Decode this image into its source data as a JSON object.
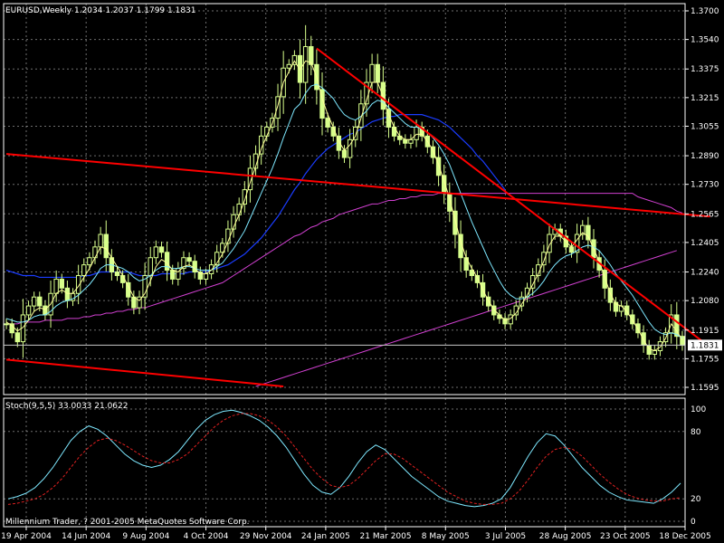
{
  "header": {
    "symbol_line": "EURUSD,Weekly  1.2034 1.2037 1.1799 1.1831",
    "stoch_line": "Stoch(9,5,5) 33.0033 21.0622",
    "copyright": "Millennium Trader, ? 2001-2005 MetaQuotes Software Corp.",
    "price_tag": "1.1831"
  },
  "colors": {
    "background": "#000000",
    "grid": "#c8c8c8",
    "candle_body": "#d8ff8c",
    "ma_fast": "#ffff99",
    "ma_mid": "#7ee8ff",
    "ma_slow": "#1a3cff",
    "ma_long": "#d040d0",
    "trendline": "#ff0000",
    "stoch_main": "#7ee8ff",
    "stoch_signal": "#e02020"
  },
  "chart_data": [
    {
      "type": "candlestick",
      "title": "EURUSD,Weekly",
      "x_tick_labels": [
        "19 Apr 2004",
        "14 Jun 2004",
        "9 Aug 2004",
        "4 Oct 2004",
        "29 Nov 2004",
        "24 Jan 2005",
        "21 Mar 2005",
        "8 May 2005",
        "3 Jul 2005",
        "28 Aug 2005",
        "23 Oct 2005",
        "18 Dec 2005"
      ],
      "y_tick_labels": [
        "1.3700",
        "1.3540",
        "1.3375",
        "1.3215",
        "1.3055",
        "1.2890",
        "1.2730",
        "1.2565",
        "1.2405",
        "1.2240",
        "1.2080",
        "1.1915",
        "1.1755",
        "1.1595"
      ],
      "ylim": [
        1.1595,
        1.37
      ],
      "current_price": 1.1831,
      "closes": [
        1.195,
        1.19,
        1.185,
        1.2,
        1.205,
        1.21,
        1.205,
        1.2,
        1.212,
        1.22,
        1.215,
        1.208,
        1.212,
        1.222,
        1.228,
        1.232,
        1.238,
        1.245,
        1.232,
        1.224,
        1.222,
        1.218,
        1.21,
        1.204,
        1.21,
        1.222,
        1.232,
        1.238,
        1.235,
        1.225,
        1.22,
        1.226,
        1.232,
        1.23,
        1.224,
        1.22,
        1.223,
        1.228,
        1.235,
        1.24,
        1.248,
        1.256,
        1.262,
        1.27,
        1.282,
        1.29,
        1.3,
        1.305,
        1.31,
        1.322,
        1.338,
        1.34,
        1.345,
        1.33,
        1.35,
        1.34,
        1.326,
        1.31,
        1.305,
        1.3,
        1.292,
        1.288,
        1.298,
        1.305,
        1.318,
        1.33,
        1.34,
        1.33,
        1.315,
        1.305,
        1.3,
        1.298,
        1.296,
        1.298,
        1.305,
        1.3,
        1.294,
        1.288,
        1.278,
        1.268,
        1.258,
        1.245,
        1.232,
        1.225,
        1.222,
        1.218,
        1.21,
        1.205,
        1.2,
        1.198,
        1.195,
        1.2,
        1.205,
        1.21,
        1.215,
        1.222,
        1.228,
        1.235,
        1.245,
        1.248,
        1.244,
        1.238,
        1.235,
        1.245,
        1.25,
        1.242,
        1.232,
        1.225,
        1.215,
        1.207,
        1.202,
        1.205,
        1.2,
        1.195,
        1.19,
        1.183,
        1.178,
        1.18,
        1.185,
        1.19,
        1.2,
        1.188,
        1.183
      ],
      "series": [
        {
          "name": "ma_fast",
          "values": [
            1.196,
            1.194,
            1.191,
            1.193,
            1.197,
            1.202,
            1.204,
            1.203,
            1.206,
            1.212,
            1.214,
            1.212,
            1.212,
            1.216,
            1.221,
            1.226,
            1.232,
            1.238,
            1.237,
            1.232,
            1.227,
            1.222,
            1.216,
            1.21,
            1.208,
            1.212,
            1.219,
            1.227,
            1.231,
            1.229,
            1.225,
            1.224,
            1.227,
            1.228,
            1.226,
            1.223,
            1.223,
            1.225,
            1.229,
            1.234,
            1.241,
            1.249,
            1.256,
            1.264,
            1.274,
            1.283,
            1.293,
            1.3,
            1.307,
            1.317,
            1.33,
            1.336,
            1.342,
            1.337,
            1.342,
            1.341,
            1.333,
            1.321,
            1.312,
            1.305,
            1.297,
            1.292,
            1.295,
            1.3,
            1.31,
            1.32,
            1.33,
            1.33,
            1.322,
            1.312,
            1.305,
            1.3,
            1.298,
            1.298,
            1.301,
            1.301,
            1.297,
            1.292,
            1.284,
            1.275,
            1.265,
            1.253,
            1.241,
            1.232,
            1.226,
            1.221,
            1.214,
            1.208,
            1.203,
            1.2,
            1.197,
            1.198,
            1.201,
            1.206,
            1.211,
            1.217,
            1.223,
            1.23,
            1.239,
            1.244,
            1.244,
            1.241,
            1.238,
            1.242,
            1.246,
            1.244,
            1.237,
            1.23,
            1.221,
            1.212,
            1.206,
            1.205,
            1.202,
            1.197,
            1.192,
            1.186,
            1.181,
            1.18,
            1.182,
            1.187,
            1.195,
            1.191,
            1.186
          ]
        },
        {
          "name": "ma_mid",
          "values": [
            1.198,
            1.197,
            1.196,
            1.196,
            1.197,
            1.199,
            1.2,
            1.2,
            1.202,
            1.205,
            1.207,
            1.208,
            1.209,
            1.211,
            1.214,
            1.217,
            1.221,
            1.226,
            1.228,
            1.228,
            1.227,
            1.226,
            1.224,
            1.221,
            1.219,
            1.22,
            1.222,
            1.225,
            1.227,
            1.227,
            1.226,
            1.226,
            1.227,
            1.227,
            1.226,
            1.225,
            1.225,
            1.225,
            1.227,
            1.229,
            1.233,
            1.237,
            1.242,
            1.247,
            1.254,
            1.261,
            1.268,
            1.275,
            1.282,
            1.29,
            1.299,
            1.307,
            1.315,
            1.318,
            1.324,
            1.328,
            1.329,
            1.327,
            1.324,
            1.321,
            1.316,
            1.312,
            1.31,
            1.309,
            1.311,
            1.314,
            1.318,
            1.32,
            1.319,
            1.316,
            1.313,
            1.31,
            1.307,
            1.305,
            1.305,
            1.304,
            1.302,
            1.299,
            1.295,
            1.29,
            1.284,
            1.276,
            1.268,
            1.26,
            1.252,
            1.245,
            1.238,
            1.231,
            1.225,
            1.219,
            1.214,
            1.211,
            1.209,
            1.209,
            1.21,
            1.212,
            1.215,
            1.219,
            1.224,
            1.228,
            1.231,
            1.233,
            1.234,
            1.236,
            1.238,
            1.239,
            1.238,
            1.236,
            1.232,
            1.228,
            1.223,
            1.219,
            1.215,
            1.211,
            1.206,
            1.201,
            1.196,
            1.192,
            1.19,
            1.189,
            1.19,
            1.189,
            1.187
          ]
        },
        {
          "name": "ma_slow",
          "values": [
            1.225,
            1.224,
            1.223,
            1.222,
            1.222,
            1.222,
            1.221,
            1.221,
            1.221,
            1.221,
            1.221,
            1.221,
            1.221,
            1.221,
            1.222,
            1.222,
            1.223,
            1.224,
            1.224,
            1.224,
            1.224,
            1.224,
            1.224,
            1.223,
            1.222,
            1.222,
            1.222,
            1.222,
            1.223,
            1.223,
            1.223,
            1.223,
            1.223,
            1.224,
            1.224,
            1.224,
            1.224,
            1.225,
            1.226,
            1.227,
            1.228,
            1.23,
            1.232,
            1.234,
            1.237,
            1.24,
            1.243,
            1.247,
            1.251,
            1.255,
            1.26,
            1.265,
            1.27,
            1.274,
            1.279,
            1.283,
            1.287,
            1.29,
            1.293,
            1.295,
            1.297,
            1.299,
            1.301,
            1.302,
            1.304,
            1.306,
            1.308,
            1.309,
            1.31,
            1.311,
            1.311,
            1.312,
            1.312,
            1.312,
            1.312,
            1.312,
            1.311,
            1.31,
            1.309,
            1.307,
            1.305,
            1.302,
            1.299,
            1.296,
            1.293,
            1.289,
            1.286,
            1.282,
            1.278,
            1.274,
            1.27
          ]
        },
        {
          "name": "ma_long",
          "values": [
            1.195,
            1.195,
            1.195,
            1.196,
            1.196,
            1.196,
            1.196,
            1.197,
            1.197,
            1.197,
            1.197,
            1.198,
            1.198,
            1.198,
            1.199,
            1.199,
            1.2,
            1.2,
            1.201,
            1.201,
            1.202,
            1.202,
            1.203,
            1.203,
            1.204,
            1.204,
            1.205,
            1.206,
            1.207,
            1.208,
            1.209,
            1.21,
            1.211,
            1.212,
            1.213,
            1.214,
            1.215,
            1.216,
            1.217,
            1.218,
            1.22,
            1.222,
            1.224,
            1.226,
            1.228,
            1.23,
            1.232,
            1.234,
            1.236,
            1.238,
            1.24,
            1.242,
            1.244,
            1.245,
            1.247,
            1.249,
            1.25,
            1.252,
            1.253,
            1.254,
            1.256,
            1.257,
            1.258,
            1.259,
            1.26,
            1.261,
            1.262,
            1.262,
            1.263,
            1.264,
            1.264,
            1.265,
            1.265,
            1.266,
            1.266,
            1.267,
            1.267,
            1.267,
            1.268,
            1.268,
            1.268,
            1.268,
            1.268,
            1.268,
            1.268,
            1.268,
            1.268,
            1.268,
            1.268,
            1.268,
            1.268,
            1.268,
            1.268,
            1.268,
            1.268,
            1.268,
            1.268,
            1.268,
            1.268,
            1.268,
            1.268,
            1.268,
            1.268,
            1.268,
            1.268,
            1.268,
            1.268,
            1.268,
            1.268,
            1.268,
            1.268,
            1.268,
            1.268,
            1.268,
            1.266,
            1.265,
            1.264,
            1.263,
            1.262,
            1.261,
            1.26,
            1.258,
            1.257
          ]
        },
        {
          "name": "ma_lower",
          "values": [
            1.16,
            1.161,
            1.162,
            1.163,
            1.164,
            1.165,
            1.166,
            1.167,
            1.168,
            1.169,
            1.17,
            1.171,
            1.172,
            1.173,
            1.174,
            1.175,
            1.176,
            1.177,
            1.178,
            1.179,
            1.18,
            1.181,
            1.182,
            1.183,
            1.184,
            1.185,
            1.186,
            1.187,
            1.188,
            1.189,
            1.19,
            1.191,
            1.192,
            1.193,
            1.194,
            1.195,
            1.196,
            1.197,
            1.198,
            1.199,
            1.2,
            1.201,
            1.202,
            1.203,
            1.204,
            1.205,
            1.206,
            1.207,
            1.208,
            1.209,
            1.21,
            1.211,
            1.212,
            1.213,
            1.214,
            1.215,
            1.216,
            1.217,
            1.218,
            1.219,
            1.22,
            1.221,
            1.222,
            1.223,
            1.224,
            1.225,
            1.226,
            1.227,
            1.228,
            1.229,
            1.23,
            1.231,
            1.232,
            1.233,
            1.234,
            1.235,
            1.236
          ]
        }
      ],
      "trendlines": [
        {
          "from": [
            0,
            1.29
          ],
          "to": [
            127,
            1.255
          ]
        },
        {
          "from": [
            0,
            1.175
          ],
          "to": [
            50,
            1.16
          ]
        },
        {
          "from": [
            56,
            1.349
          ],
          "to": [
            127,
            1.182
          ]
        }
      ]
    },
    {
      "type": "line",
      "title": "Stoch(9,5,5) 33.0033 21.0622",
      "y_tick_labels": [
        "100",
        "80",
        "20",
        "0"
      ],
      "ylim": [
        0,
        100
      ],
      "series": [
        {
          "name": "main",
          "values": [
            20,
            22,
            25,
            30,
            38,
            48,
            60,
            72,
            80,
            85,
            82,
            76,
            68,
            60,
            54,
            50,
            48,
            50,
            55,
            62,
            72,
            82,
            90,
            95,
            98,
            99,
            97,
            94,
            90,
            84,
            76,
            66,
            54,
            42,
            32,
            26,
            24,
            30,
            40,
            52,
            62,
            68,
            64,
            56,
            48,
            40,
            34,
            28,
            22,
            18,
            16,
            14,
            13,
            14,
            16,
            20,
            30,
            44,
            58,
            70,
            78,
            76,
            68,
            58,
            48,
            40,
            32,
            26,
            22,
            19,
            18,
            17,
            16,
            20,
            26,
            34
          ]
        },
        {
          "name": "signal",
          "values": [
            15,
            16,
            18,
            20,
            24,
            30,
            38,
            48,
            58,
            66,
            72,
            74,
            72,
            68,
            63,
            58,
            54,
            52,
            52,
            55,
            60,
            68,
            76,
            84,
            90,
            94,
            96,
            96,
            94,
            90,
            84,
            76,
            66,
            56,
            46,
            38,
            32,
            30,
            32,
            38,
            46,
            54,
            60,
            60,
            56,
            50,
            44,
            38,
            32,
            26,
            22,
            18,
            16,
            15,
            15,
            16,
            20,
            27,
            37,
            48,
            58,
            64,
            66,
            64,
            58,
            50,
            42,
            35,
            29,
            24,
            21,
            19,
            18,
            18,
            20,
            21
          ]
        }
      ]
    }
  ]
}
